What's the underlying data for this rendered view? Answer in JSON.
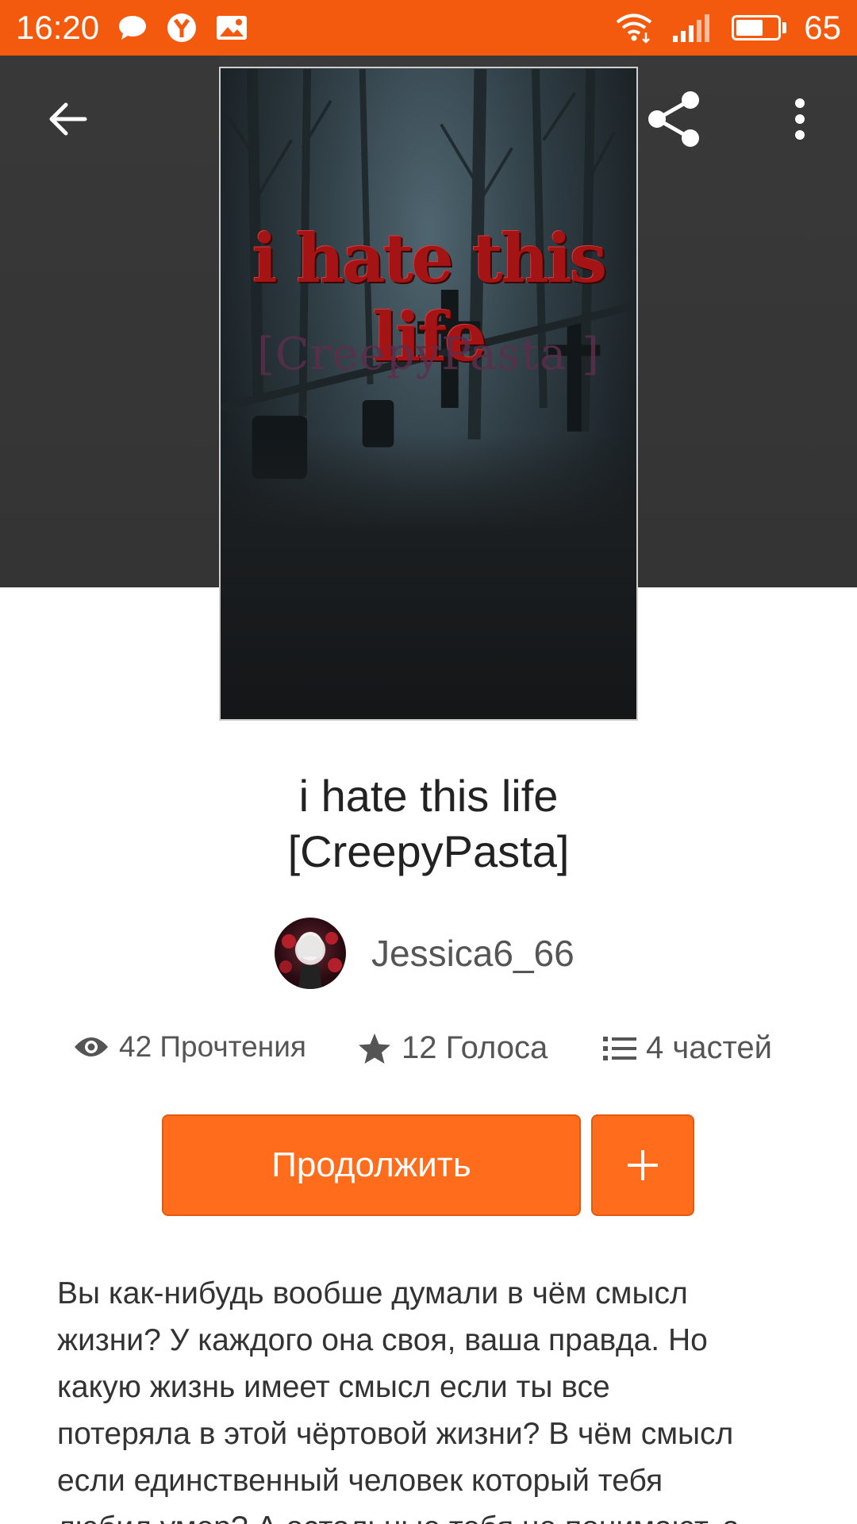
{
  "status_bar": {
    "time": "16:20",
    "battery": "65",
    "battery_level": 0.65,
    "icons": [
      "chat-bubble-icon",
      "yandex-browser-icon",
      "gallery-icon",
      "wifi-icon",
      "signal-icon",
      "battery-icon"
    ]
  },
  "toolbar": {
    "back_icon": "arrow-left-icon",
    "share_icon": "share-icon",
    "more_icon": "more-vert-icon"
  },
  "cover": {
    "title_text": "i hate this life",
    "subtitle_text": "[CreepyPasta ]"
  },
  "story": {
    "title_line1": "i hate this life",
    "title_line2": "[CreepyPasta]"
  },
  "author": {
    "name": "Jessica6_66"
  },
  "stats": {
    "reads": "42 Прочтения",
    "votes": "12 Голоса",
    "parts": "4 частей"
  },
  "actions": {
    "continue_label": "Продолжить",
    "add_label": "+"
  },
  "description": {
    "lines": [
      "Вы как-нибудь вообше думали в чём смысл",
      "жизни? У каждого она своя, ваша правда. Но",
      "какую жизнь имеет смысл если ты все",
      "потеряла в этой чёртовой жизни? В чём смысл",
      "если единственный человек который тебя",
      "любил умер? А остальные тебя не понимают, а"
    ]
  },
  "colors": {
    "accent": "#f45a0e",
    "button": "#fe6c1c",
    "header_bg": "#3a3a3a"
  }
}
